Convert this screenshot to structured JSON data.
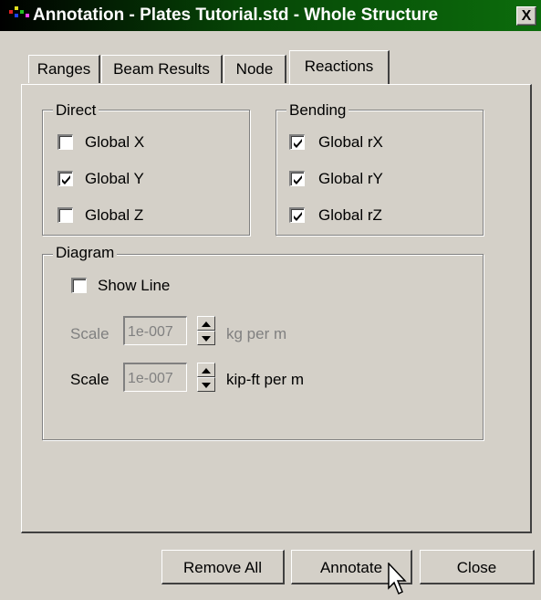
{
  "window": {
    "title": "Annotation - Plates Tutorial.std - Whole Structure",
    "close_glyph": "X"
  },
  "tabs": [
    {
      "label": "Ranges",
      "active": false
    },
    {
      "label": "Beam Results",
      "active": false
    },
    {
      "label": "Node",
      "active": false
    },
    {
      "label": "Reactions",
      "active": true
    }
  ],
  "direct": {
    "legend": "Direct",
    "items": [
      {
        "label": "Global X",
        "checked": false
      },
      {
        "label": "Global Y",
        "checked": true
      },
      {
        "label": "Global Z",
        "checked": false
      }
    ]
  },
  "bending": {
    "legend": "Bending",
    "items": [
      {
        "label": "Global rX",
        "checked": true
      },
      {
        "label": "Global rY",
        "checked": true
      },
      {
        "label": "Global rZ",
        "checked": true
      }
    ]
  },
  "diagram": {
    "legend": "Diagram",
    "show_line": {
      "label": "Show Line",
      "checked": false
    },
    "scale1": {
      "label": "Scale",
      "value": "1e-007",
      "unit": "kg per m",
      "enabled": false
    },
    "scale2": {
      "label": "Scale",
      "value": "1e-007",
      "unit": "kip-ft per m",
      "enabled": true
    }
  },
  "buttons": {
    "remove_all": "Remove All",
    "annotate": "Annotate",
    "close": "Close"
  },
  "colors": {
    "titlebar_start": "#000000",
    "titlebar_end": "#0c6c0c",
    "dialog_bg": "#d4d0c8"
  }
}
